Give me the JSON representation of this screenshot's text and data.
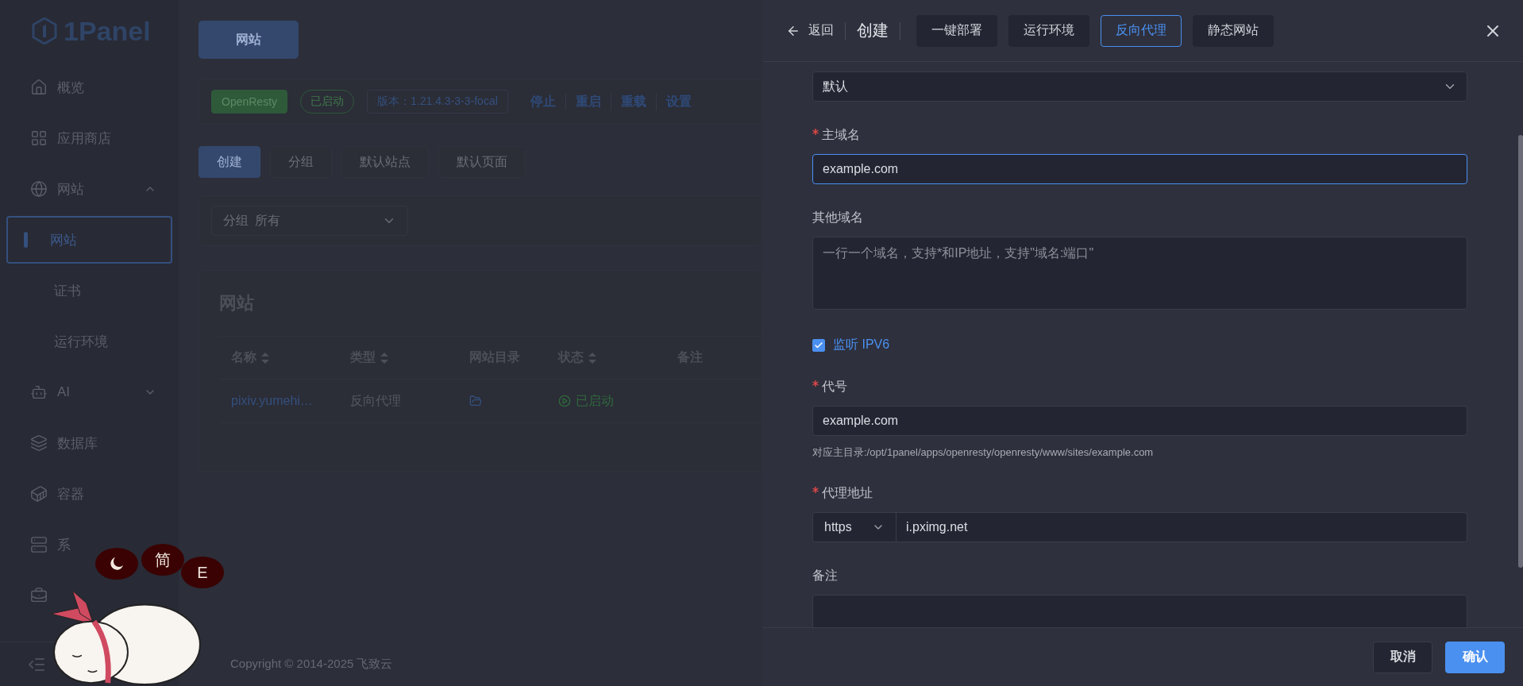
{
  "sidebar": {
    "logo": "1Panel",
    "items": [
      {
        "label": "概览",
        "selected": false
      },
      {
        "label": "应用商店",
        "selected": false
      },
      {
        "label": "网站",
        "selected": false,
        "expanded": true,
        "children": [
          {
            "label": "网站",
            "selected": true
          },
          {
            "label": "证书",
            "selected": false
          },
          {
            "label": "运行环境",
            "selected": false
          }
        ]
      },
      {
        "label": "AI",
        "selected": false,
        "expanded": false
      },
      {
        "label": "数据库",
        "selected": false
      },
      {
        "label": "容器",
        "selected": false
      },
      {
        "label": "系",
        "selected": false
      },
      {
        "selected": false
      }
    ]
  },
  "main": {
    "page_tab": "网站",
    "app_bar": {
      "name": "OpenResty",
      "status": "已启动",
      "version": "版本：1.21.4.3-3-3-focal",
      "actions": [
        "停止",
        "重启",
        "重载",
        "设置"
      ]
    },
    "toolbar": [
      {
        "label": "创建",
        "kind": "primary"
      },
      {
        "label": "分组",
        "kind": "default"
      },
      {
        "label": "默认站点",
        "kind": "default"
      },
      {
        "label": "默认页面",
        "kind": "default"
      }
    ],
    "filter": {
      "label": "分组",
      "value": "所有"
    },
    "table": {
      "title": "网站",
      "columns": [
        {
          "label": "名称",
          "sortable": true
        },
        {
          "label": "类型",
          "sortable": true
        },
        {
          "label": "网站目录",
          "sortable": false
        },
        {
          "label": "状态",
          "sortable": true
        },
        {
          "label": "备注",
          "sortable": false
        }
      ],
      "rows": [
        {
          "name": "pixiv.yumehi…",
          "type": "反向代理",
          "status": "已启动"
        }
      ]
    },
    "copyright": "Copyright © 2014-2025 飞致云"
  },
  "drawer": {
    "back": "返回",
    "title": "创建",
    "tabs": [
      {
        "label": "一键部署",
        "selected": false
      },
      {
        "label": "运行环境",
        "selected": false
      },
      {
        "label": "反向代理",
        "selected": true
      },
      {
        "label": "静态网站",
        "selected": false
      }
    ],
    "fields": [
      {
        "kind": "select",
        "value": "默认"
      },
      {
        "kind": "input",
        "label": "主域名",
        "required": true,
        "value": "example.com",
        "focused": true
      },
      {
        "kind": "textarea",
        "label": "其他域名",
        "required": false,
        "placeholder": "一行一个域名，支持*和IP地址，支持\"域名:端口\""
      },
      {
        "kind": "checkbox",
        "label": "监听 IPV6",
        "checked": true
      },
      {
        "kind": "input",
        "label": "代号",
        "required": true,
        "value": "example.com",
        "focused": false,
        "hint": "对应主目录:/opt/1panel/apps/openresty/openresty/www/sites/example.com"
      },
      {
        "kind": "input_group",
        "label": "代理地址",
        "required": true,
        "prefix": "https",
        "value": "i.pximg.net"
      },
      {
        "kind": "textarea",
        "label": "备注",
        "required": false
      }
    ],
    "buttons": [
      {
        "label": "取消",
        "kind": "default"
      },
      {
        "label": "确认",
        "kind": "primary"
      }
    ]
  },
  "cat_widget": {
    "bubbles": [
      "简",
      "E"
    ]
  }
}
